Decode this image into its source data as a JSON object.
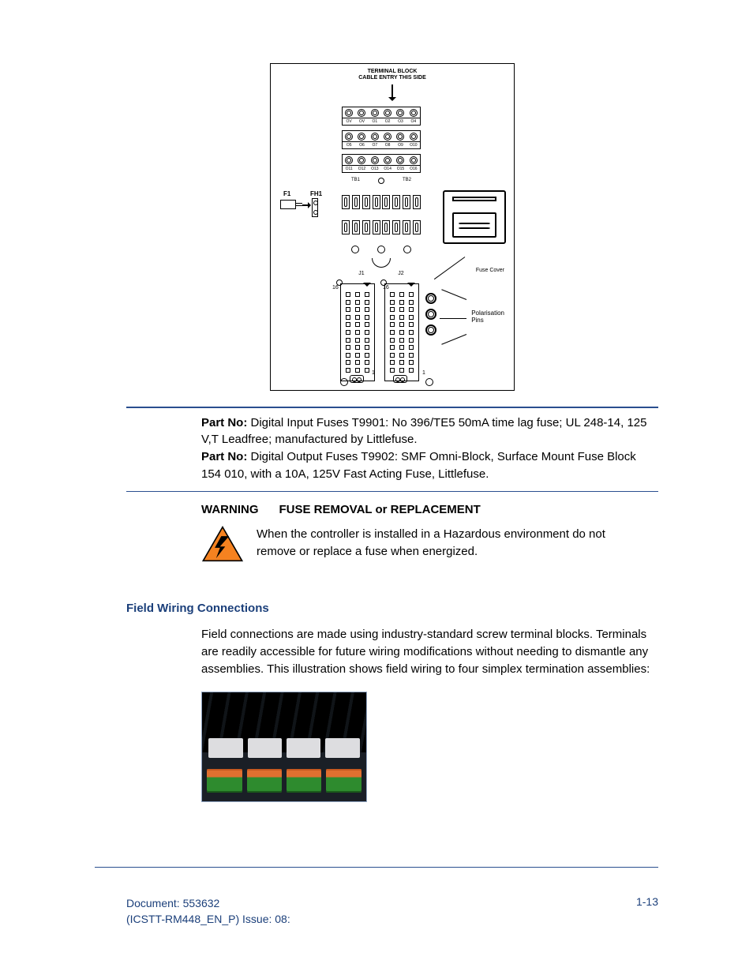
{
  "diagram": {
    "terminal_block_label_l1": "TERMINAL BLOCK",
    "terminal_block_label_l2": "CABLE ENTRY THIS SIDE",
    "row1": [
      "OV",
      "OV",
      "O1",
      "O2",
      "O3",
      "O4"
    ],
    "row2": [
      "O5",
      "O6",
      "O7",
      "O8",
      "O9",
      "O10"
    ],
    "row3": [
      "O11",
      "O12",
      "O13",
      "O14",
      "O15",
      "O16"
    ],
    "tb1": "TB1",
    "tb2": "TB2",
    "f1": "F1",
    "fh1": "FH1",
    "j1": "J1",
    "j2": "J2",
    "sixteen": "16",
    "one": "1",
    "fuse_cover": "Fuse Cover",
    "polarisation_l1": "Polarisation",
    "polarisation_l2": "Pins"
  },
  "partno": {
    "label": "Part No:",
    "p1a": " Digital Input Fuses T9901:  No 396/TE5 50mA time lag fuse; UL 248-14, 125 V,T Leadfree; manufactured by Littlefuse.",
    "p2a": " Digital Output Fuses T9902:  SMF Omni-Block, Surface Mount Fuse Block 154 010, with a 10A, 125V Fast Acting Fuse, Littlefuse."
  },
  "warning": {
    "label": "WARNING",
    "title": "FUSE REMOVAL or REPLACEMENT",
    "body": "When the controller is installed in a Hazardous environment do not remove or replace a fuse when energized."
  },
  "section": {
    "title": "Field Wiring Connections",
    "body": "Field connections are made using industry-standard screw terminal blocks. Terminals are readily accessible for future wiring modifications without needing to dismantle any assemblies. This illustration shows field wiring to four simplex termination assemblies:"
  },
  "footer": {
    "doc": "Document: 553632",
    "issue": "(ICSTT-RM448_EN_P) Issue: 08:",
    "page": "1-13"
  }
}
